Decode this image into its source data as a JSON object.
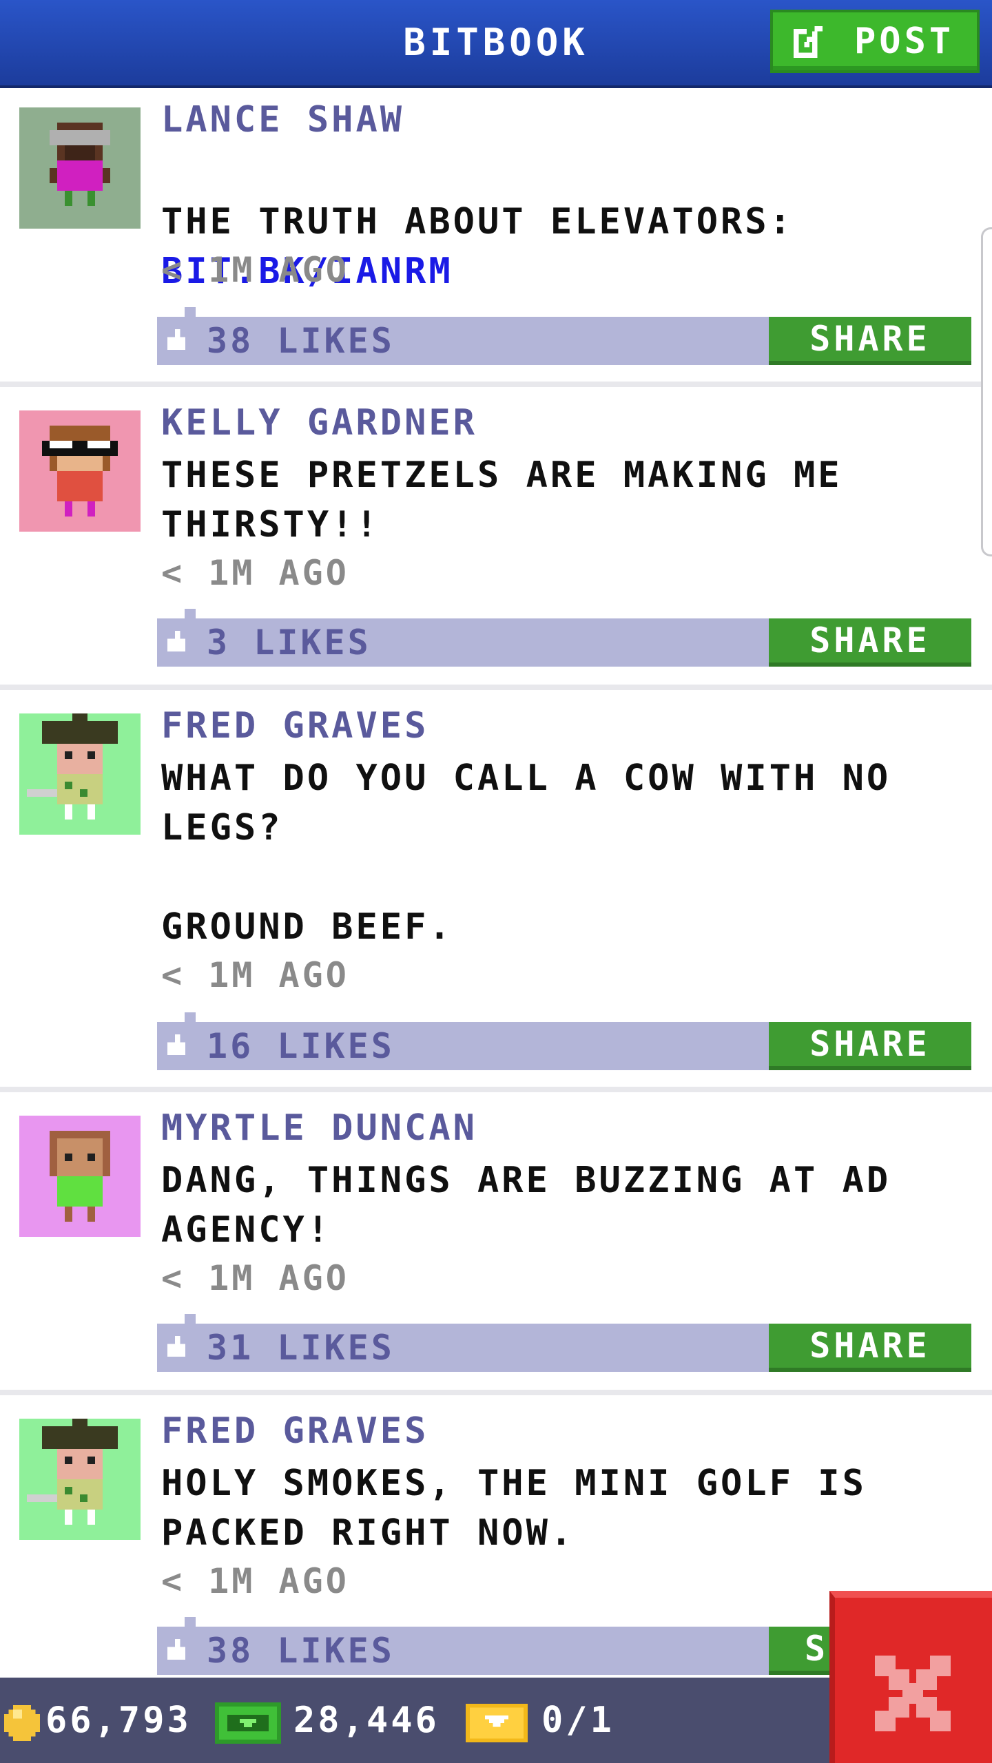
{
  "header": {
    "title": "BITBOOK",
    "post_label": "POST"
  },
  "posts": [
    {
      "author": "LANCE SHAW",
      "message": "THE TRUTH ABOUT ELEVATORS:",
      "link": "BIT.BK/IANRM",
      "time": "< 1M AGO",
      "likes": "38 LIKES",
      "share": "SHARE",
      "avatar_bg": "#8fae8f"
    },
    {
      "author": "KELLY GARDNER",
      "message": "THESE PRETZELS ARE MAKING ME\nTHIRSTY!!",
      "time": "< 1M AGO",
      "likes": "3 LIKES",
      "share": "SHARE",
      "avatar_bg": "#f096b0"
    },
    {
      "author": "FRED GRAVES",
      "message": "WHAT DO YOU CALL A COW WITH NO\nLEGS?\n\nGROUND BEEF.",
      "time": "< 1M AGO",
      "likes": "16 LIKES",
      "share": "SHARE",
      "avatar_bg": "#8ff09a"
    },
    {
      "author": "MYRTLE DUNCAN",
      "message": "DANG, THINGS ARE BUZZING AT AD\nAGENCY!",
      "time": "< 1M AGO",
      "likes": "31 LIKES",
      "share": "SHARE",
      "avatar_bg": "#e896f0"
    },
    {
      "author": "FRED GRAVES",
      "message": "HOLY SMOKES, THE MINI GOLF IS\nPACKED RIGHT NOW.",
      "time": "< 1M AGO",
      "likes": "38 LIKES",
      "share": "S",
      "avatar_bg": "#8ff09a"
    }
  ],
  "status_bar": {
    "coins": "66,793",
    "bux": "28,446",
    "tickets": "0/1"
  },
  "colors": {
    "header_blue": "#2a55c8",
    "post_green": "#3db82c",
    "share_green": "#3f9c32",
    "like_bar": "#b3b5d8",
    "author_text": "#5a5a9c",
    "link_blue": "#1a1ae6",
    "close_red": "#e02828",
    "status_bg": "#4a4d6e"
  },
  "icons": {
    "post": "edit-icon",
    "like": "thumbs-up-icon",
    "coin": "coin-icon",
    "bux": "bux-icon",
    "ticket": "ticket-icon",
    "close": "close-icon"
  }
}
